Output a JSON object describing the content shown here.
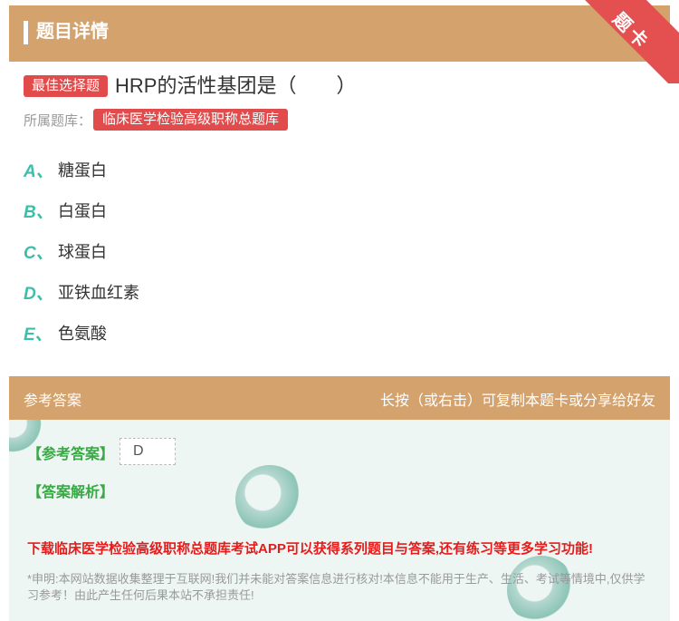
{
  "header": {
    "title": "题目详情"
  },
  "ribbon": {
    "text": "题卡"
  },
  "question": {
    "type_tag": "最佳选择题",
    "text": "HRP的活性基团是（　　）",
    "bank_label": "所属题库：",
    "bank_name": "临床医学检验高级职称总题库"
  },
  "options": [
    {
      "key": "A、",
      "text": "糖蛋白"
    },
    {
      "key": "B、",
      "text": "白蛋白"
    },
    {
      "key": "C、",
      "text": "球蛋白"
    },
    {
      "key": "D、",
      "text": "亚铁血红素"
    },
    {
      "key": "E、",
      "text": "色氨酸"
    }
  ],
  "answer_section": {
    "title": "参考答案",
    "hint": "长按（或右击）可复制本题卡或分享给好友",
    "answer_label": "【参考答案】",
    "answer_value": "D",
    "analysis_label": "【答案解析】",
    "promo": "下载临床医学检验高级职称总题库考试APP可以获得系列题目与答案,还有练习等更多学习功能!",
    "disclaimer": "*申明:本网站数据收集整理于互联网!我们并未能对答案信息进行核对!本信息不能用于生产、生活、考试等情境中,仅供学习参考！由此产生任何后果本站不承担责任!"
  },
  "colors": {
    "accent": "#d4a26c",
    "tag_red": "#e24b4b",
    "option_key": "#3cbfa8",
    "answer_green": "#3aa845",
    "promo_red": "#e61b1b"
  }
}
